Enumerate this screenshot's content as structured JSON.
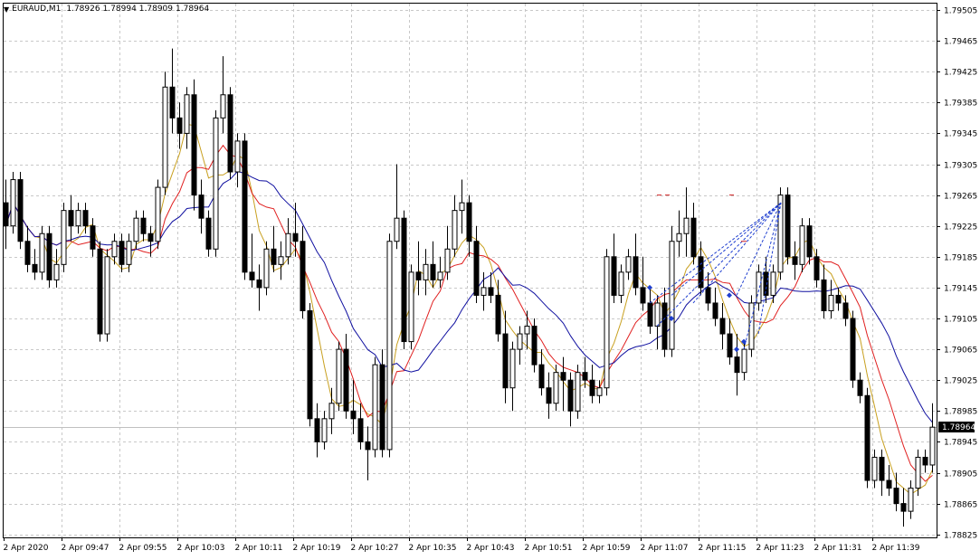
{
  "header": {
    "symbol_timeframe": "EURAUD,M1",
    "ohlc": [
      "1.78926",
      "1.78994",
      "1.78909",
      "1.78964"
    ],
    "caret_icon": "triangle-down"
  },
  "price_axis": {
    "ticks": [
      "1.79505",
      "1.79465",
      "1.79425",
      "1.79385",
      "1.79345",
      "1.79305",
      "1.79265",
      "1.79225",
      "1.79185",
      "1.79145",
      "1.79105",
      "1.79065",
      "1.79025",
      "1.78985",
      "1.78945",
      "1.78905",
      "1.78865",
      "1.78825"
    ],
    "current_price": "1.78964",
    "range": [
      1.78825,
      1.79505
    ]
  },
  "time_axis": {
    "ticks": [
      "2 Apr 2020",
      "2 Apr 09:47",
      "2 Apr 09:55",
      "2 Apr 10:03",
      "2 Apr 10:11",
      "2 Apr 10:19",
      "2 Apr 10:27",
      "2 Apr 10:35",
      "2 Apr 10:43",
      "2 Apr 10:51",
      "2 Apr 10:59",
      "2 Apr 11:07",
      "2 Apr 11:15",
      "2 Apr 11:23",
      "2 Apr 11:31",
      "2 Apr 11:39"
    ]
  },
  "colors": {
    "background": "#ffffff",
    "grid": "#c8c8c8",
    "bull_body": "#ffffff",
    "bear_body": "#000000",
    "wick": "#000000",
    "ma_fast": "#c8a020",
    "ma_mid": "#e02020",
    "ma_slow": "#1010a0",
    "objects": "#1f3fd0",
    "markers": "#d02020"
  },
  "chart_data": {
    "type": "candlestick",
    "timeframe": "M1",
    "candles": [
      [
        1.79255,
        1.79285,
        1.79195,
        1.79225
      ],
      [
        1.79225,
        1.79295,
        1.79215,
        1.79285
      ],
      [
        1.79285,
        1.79295,
        1.79195,
        1.79205
      ],
      [
        1.79205,
        1.79225,
        1.79165,
        1.79175
      ],
      [
        1.79175,
        1.79195,
        1.79155,
        1.79165
      ],
      [
        1.79165,
        1.79225,
        1.79155,
        1.79215
      ],
      [
        1.79215,
        1.79225,
        1.79145,
        1.79155
      ],
      [
        1.79155,
        1.79195,
        1.79145,
        1.79175
      ],
      [
        1.79175,
        1.79255,
        1.79165,
        1.79245
      ],
      [
        1.79245,
        1.79265,
        1.79205,
        1.79225
      ],
      [
        1.79225,
        1.79255,
        1.79215,
        1.79245
      ],
      [
        1.79245,
        1.79255,
        1.79215,
        1.79225
      ],
      [
        1.79225,
        1.79235,
        1.79185,
        1.79195
      ],
      [
        1.79195,
        1.79205,
        1.79075,
        1.79085
      ],
      [
        1.79085,
        1.79195,
        1.79075,
        1.79185
      ],
      [
        1.79185,
        1.79215,
        1.79175,
        1.79205
      ],
      [
        1.79205,
        1.79215,
        1.79165,
        1.79175
      ],
      [
        1.79175,
        1.79215,
        1.79165,
        1.79205
      ],
      [
        1.79205,
        1.79245,
        1.79195,
        1.79235
      ],
      [
        1.79235,
        1.79245,
        1.79205,
        1.79215
      ],
      [
        1.79215,
        1.79225,
        1.79185,
        1.79205
      ],
      [
        1.79205,
        1.79285,
        1.79195,
        1.79275
      ],
      [
        1.79275,
        1.79425,
        1.79265,
        1.79405
      ],
      [
        1.79405,
        1.79455,
        1.79345,
        1.79365
      ],
      [
        1.79365,
        1.79385,
        1.79325,
        1.79345
      ],
      [
        1.79345,
        1.79405,
        1.79325,
        1.79395
      ],
      [
        1.79395,
        1.79415,
        1.79245,
        1.79265
      ],
      [
        1.79265,
        1.79285,
        1.79215,
        1.79235
      ],
      [
        1.79235,
        1.79245,
        1.79185,
        1.79195
      ],
      [
        1.79195,
        1.79375,
        1.79185,
        1.79365
      ],
      [
        1.79365,
        1.79445,
        1.79345,
        1.79395
      ],
      [
        1.79395,
        1.79405,
        1.79285,
        1.79295
      ],
      [
        1.79295,
        1.79345,
        1.79275,
        1.79335
      ],
      [
        1.79335,
        1.79345,
        1.79155,
        1.79165
      ],
      [
        1.79165,
        1.79215,
        1.79145,
        1.79155
      ],
      [
        1.79155,
        1.79175,
        1.79115,
        1.79145
      ],
      [
        1.79145,
        1.79205,
        1.79135,
        1.79195
      ],
      [
        1.79195,
        1.79225,
        1.79165,
        1.79175
      ],
      [
        1.79175,
        1.79205,
        1.79155,
        1.79185
      ],
      [
        1.79185,
        1.79235,
        1.79175,
        1.79215
      ],
      [
        1.79215,
        1.79255,
        1.79185,
        1.79205
      ],
      [
        1.79205,
        1.79225,
        1.79105,
        1.79115
      ],
      [
        1.79115,
        1.79125,
        1.78965,
        1.78975
      ],
      [
        1.78975,
        1.78995,
        1.78925,
        1.78945
      ],
      [
        1.78945,
        1.78985,
        1.78935,
        1.78975
      ],
      [
        1.78975,
        1.79015,
        1.78955,
        1.78995
      ],
      [
        1.78995,
        1.79075,
        1.78985,
        1.79065
      ],
      [
        1.79065,
        1.79085,
        1.78975,
        1.78985
      ],
      [
        1.78985,
        1.79025,
        1.78955,
        1.78975
      ],
      [
        1.78975,
        1.78995,
        1.78935,
        1.78945
      ],
      [
        1.78945,
        1.78965,
        1.78895,
        1.78935
      ],
      [
        1.78935,
        1.79055,
        1.78925,
        1.79045
      ],
      [
        1.79045,
        1.79065,
        1.78925,
        1.78935
      ],
      [
        1.78935,
        1.79215,
        1.78925,
        1.79205
      ],
      [
        1.79205,
        1.79305,
        1.79195,
        1.79235
      ],
      [
        1.79235,
        1.79245,
        1.79065,
        1.79075
      ],
      [
        1.79075,
        1.79175,
        1.79065,
        1.79165
      ],
      [
        1.79165,
        1.79205,
        1.79135,
        1.79155
      ],
      [
        1.79155,
        1.79195,
        1.79135,
        1.79175
      ],
      [
        1.79175,
        1.79205,
        1.79145,
        1.79155
      ],
      [
        1.79155,
        1.79185,
        1.79145,
        1.79165
      ],
      [
        1.79165,
        1.79225,
        1.79155,
        1.79195
      ],
      [
        1.79195,
        1.79265,
        1.79185,
        1.79245
      ],
      [
        1.79245,
        1.79285,
        1.79215,
        1.79255
      ],
      [
        1.79255,
        1.79265,
        1.79185,
        1.79205
      ],
      [
        1.79205,
        1.79225,
        1.79125,
        1.79135
      ],
      [
        1.79135,
        1.79165,
        1.79115,
        1.79145
      ],
      [
        1.79145,
        1.79165,
        1.79125,
        1.79135
      ],
      [
        1.79135,
        1.79155,
        1.79075,
        1.79085
      ],
      [
        1.79085,
        1.79115,
        1.78995,
        1.79015
      ],
      [
        1.79015,
        1.79075,
        1.78985,
        1.79065
      ],
      [
        1.79065,
        1.79095,
        1.79045,
        1.79085
      ],
      [
        1.79085,
        1.79115,
        1.79065,
        1.79095
      ],
      [
        1.79095,
        1.79105,
        1.79035,
        1.79045
      ],
      [
        1.79045,
        1.79065,
        1.79005,
        1.79015
      ],
      [
        1.79015,
        1.79035,
        1.78975,
        1.78995
      ],
      [
        1.78995,
        1.79045,
        1.78985,
        1.79035
      ],
      [
        1.79035,
        1.79055,
        1.78985,
        1.79025
      ],
      [
        1.79025,
        1.79035,
        1.78965,
        1.78985
      ],
      [
        1.78985,
        1.79045,
        1.78975,
        1.79035
      ],
      [
        1.79035,
        1.79055,
        1.79015,
        1.79025
      ],
      [
        1.79025,
        1.79045,
        1.78995,
        1.79005
      ],
      [
        1.79005,
        1.79025,
        1.78995,
        1.79015
      ],
      [
        1.79015,
        1.79195,
        1.79005,
        1.79185
      ],
      [
        1.79185,
        1.79215,
        1.79125,
        1.79135
      ],
      [
        1.79135,
        1.79175,
        1.79125,
        1.79165
      ],
      [
        1.79165,
        1.79195,
        1.79155,
        1.79185
      ],
      [
        1.79185,
        1.79215,
        1.79135,
        1.79145
      ],
      [
        1.79145,
        1.79185,
        1.79115,
        1.79125
      ],
      [
        1.79125,
        1.79145,
        1.79085,
        1.79095
      ],
      [
        1.79095,
        1.79135,
        1.79065,
        1.79125
      ],
      [
        1.79125,
        1.79145,
        1.79055,
        1.79065
      ],
      [
        1.79065,
        1.79225,
        1.79055,
        1.79205
      ],
      [
        1.79205,
        1.79245,
        1.79185,
        1.79215
      ],
      [
        1.79215,
        1.79275,
        1.79185,
        1.79235
      ],
      [
        1.79235,
        1.79255,
        1.79175,
        1.79185
      ],
      [
        1.79185,
        1.79205,
        1.79135,
        1.79145
      ],
      [
        1.79145,
        1.79165,
        1.79115,
        1.79125
      ],
      [
        1.79125,
        1.79145,
        1.79095,
        1.79105
      ],
      [
        1.79105,
        1.79125,
        1.79065,
        1.79085
      ],
      [
        1.79085,
        1.79105,
        1.79045,
        1.79055
      ],
      [
        1.79055,
        1.79085,
        1.79005,
        1.79035
      ],
      [
        1.79035,
        1.79075,
        1.79025,
        1.79065
      ],
      [
        1.79065,
        1.79135,
        1.79055,
        1.79125
      ],
      [
        1.79125,
        1.79175,
        1.79115,
        1.79165
      ],
      [
        1.79165,
        1.79185,
        1.79125,
        1.79135
      ],
      [
        1.79135,
        1.79175,
        1.79125,
        1.79165
      ],
      [
        1.79165,
        1.79275,
        1.79155,
        1.79265
      ],
      [
        1.79265,
        1.79275,
        1.79175,
        1.79185
      ],
      [
        1.79185,
        1.79205,
        1.79155,
        1.79175
      ],
      [
        1.79175,
        1.79235,
        1.79165,
        1.79225
      ],
      [
        1.79225,
        1.79235,
        1.79175,
        1.79185
      ],
      [
        1.79185,
        1.79195,
        1.79145,
        1.79155
      ],
      [
        1.79155,
        1.79175,
        1.79105,
        1.79115
      ],
      [
        1.79115,
        1.79155,
        1.79105,
        1.79135
      ],
      [
        1.79135,
        1.79145,
        1.79115,
        1.79125
      ],
      [
        1.79125,
        1.79135,
        1.79095,
        1.79105
      ],
      [
        1.79105,
        1.79115,
        1.79015,
        1.79025
      ],
      [
        1.79025,
        1.79035,
        1.78995,
        1.79005
      ],
      [
        1.79005,
        1.79015,
        1.78885,
        1.78895
      ],
      [
        1.78895,
        1.78935,
        1.78885,
        1.78925
      ],
      [
        1.78925,
        1.78935,
        1.78875,
        1.78895
      ],
      [
        1.78895,
        1.78915,
        1.78875,
        1.78885
      ],
      [
        1.78885,
        1.78905,
        1.78855,
        1.78865
      ],
      [
        1.78865,
        1.78885,
        1.78835,
        1.78855
      ],
      [
        1.78855,
        1.78895,
        1.78845,
        1.78885
      ],
      [
        1.78885,
        1.78935,
        1.78875,
        1.78925
      ],
      [
        1.78925,
        1.78935,
        1.78905,
        1.78915
      ],
      [
        1.78915,
        1.78995,
        1.78905,
        1.78964
      ]
    ],
    "overlays": [
      "moving-average-fast",
      "moving-average-mid",
      "moving-average-slow",
      "fan-lines",
      "level-markers"
    ],
    "grid": true
  }
}
